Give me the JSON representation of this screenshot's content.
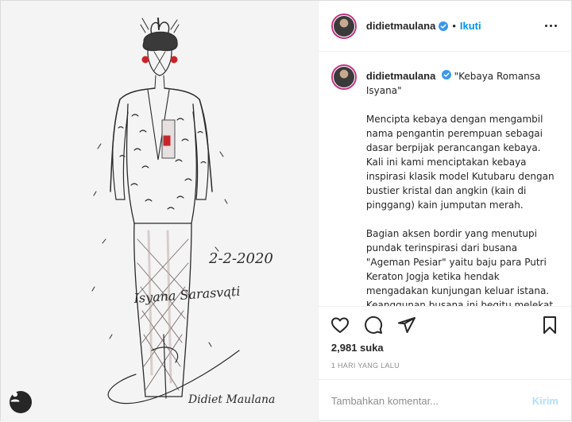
{
  "post": {
    "username": "didietmaulana",
    "follow_label": "Ikuti",
    "separator": "•",
    "caption": {
      "title": "\"Kebaya Romansa Isyana\"",
      "paragraphs": [
        "Mencipta kebaya dengan mengambil nama pengantin perempuan sebagai dasar berpijak perancangan kebaya. Kali ini kami menciptakan kebaya inspirasi klasik model Kutubaru dengan bustier kristal dan angkin (kain di pinggang) kain jumputan merah.",
        "Bagian aksen bordir yang menutupi pundak terinspirasi dari busana \"Ageman Pesiar\" yaitu baju para Putri Keraton Jogja ketika hendak mengadakan kunjungan keluar istana. Keanggunan busana ini begitu melekat padaku, sehingga"
      ]
    },
    "likes": "2,981 suka",
    "date": "1 HARI YANG LALU",
    "comment_placeholder": "Tambahkan komentar...",
    "post_button": "Kirim"
  },
  "sketch": {
    "date_text": "2-2-2020",
    "name_text": "Isyana Sarasvati",
    "signature_text": "Didiet Maulana"
  },
  "colors": {
    "follow_blue": "#0095f6",
    "verified_blue": "#3897f0",
    "post_button_disabled": "#b2dffc",
    "secondary_text": "#8e8e8e",
    "story_ring": "#c13584",
    "sketch_accent_red": "#c8252b"
  },
  "icons": {
    "verified": "verified-badge-icon",
    "more": "more-options-icon",
    "like": "heart-icon",
    "comment": "comment-bubble-icon",
    "share": "paper-plane-icon",
    "save": "bookmark-icon",
    "tagged_user": "user-tag-icon"
  }
}
